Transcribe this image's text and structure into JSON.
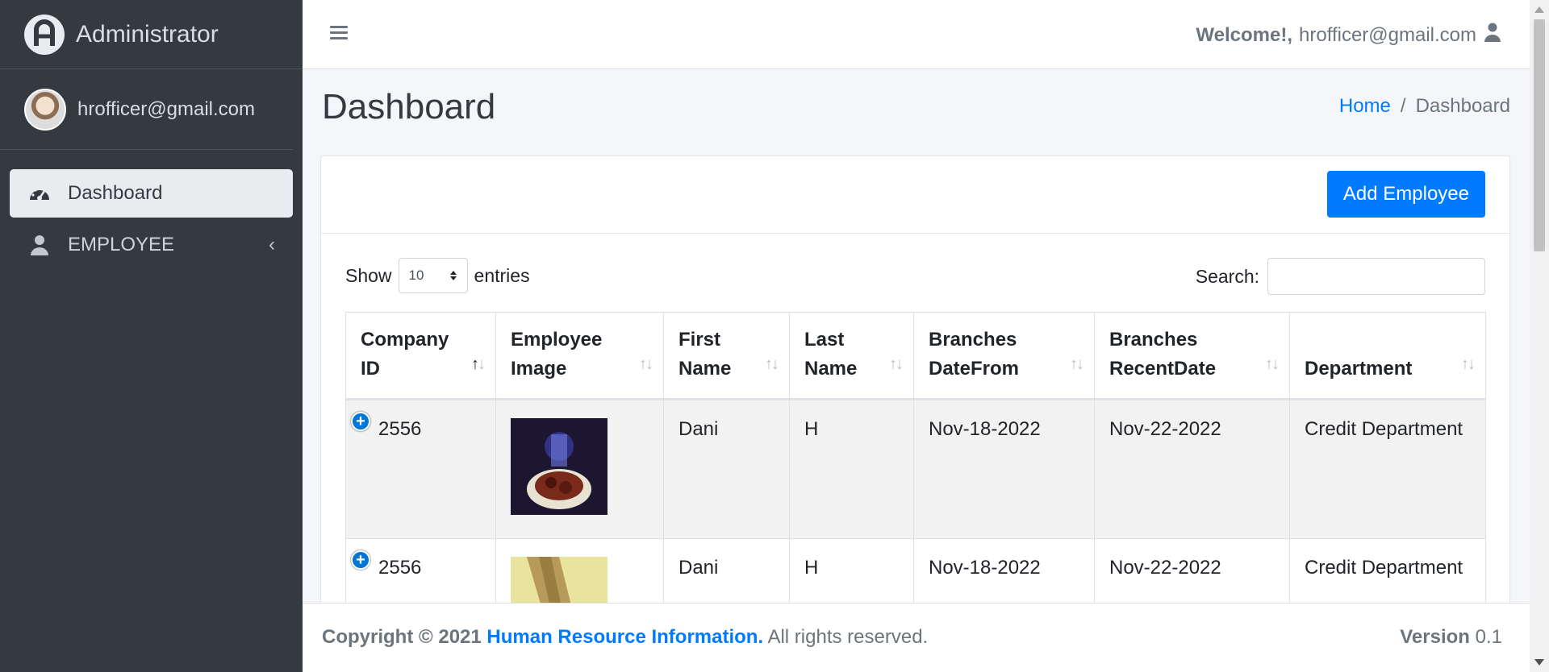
{
  "brand": {
    "title": "Administrator",
    "logo_icon": "ar-logo-icon"
  },
  "user": {
    "email": "hrofficer@gmail.com"
  },
  "sidebar": {
    "items": [
      {
        "label": "Dashboard",
        "icon": "tachometer-icon",
        "active": true
      },
      {
        "label": "EMPLOYEE",
        "icon": "user-icon",
        "active": false
      }
    ]
  },
  "header": {
    "welcome": "Welcome!,",
    "email": "hrofficer@gmail.com"
  },
  "page": {
    "title": "Dashboard",
    "breadcrumb": {
      "home": "Home",
      "separator": "/",
      "current": "Dashboard"
    }
  },
  "card": {
    "add_button": "Add Employee",
    "show_label": "Show",
    "entries_value": "10",
    "entries_label": "entries",
    "search_label": "Search:",
    "search_value": ""
  },
  "table": {
    "columns": [
      {
        "line1": "Company",
        "line2": "ID"
      },
      {
        "line1": "Employee",
        "line2": "Image"
      },
      {
        "line1": "First",
        "line2": "Name"
      },
      {
        "line1": "Last",
        "line2": "Name"
      },
      {
        "line1": "Branches",
        "line2": "DateFrom"
      },
      {
        "line1": "Branches",
        "line2": "RecentDate"
      },
      {
        "line1": "",
        "line2": "Department"
      }
    ],
    "rows": [
      {
        "company_id": "2556",
        "first_name": "Dani",
        "last_name": "H",
        "date_from": "Nov-18-2022",
        "recent_date": "Nov-22-2022",
        "department": "Credit Department"
      },
      {
        "company_id": "2556",
        "first_name": "Dani",
        "last_name": "H",
        "date_from": "Nov-18-2022",
        "recent_date": "Nov-22-2022",
        "department": "Credit Department"
      }
    ]
  },
  "footer": {
    "copyright_prefix": "Copyright © 2021",
    "org": "Human Resource Information.",
    "rights": "All rights reserved.",
    "version_label": "Version",
    "version_value": "0.1"
  },
  "colors": {
    "sidebar": "#343a40",
    "accent": "#007bff",
    "content_bg": "#f4f6f9"
  }
}
